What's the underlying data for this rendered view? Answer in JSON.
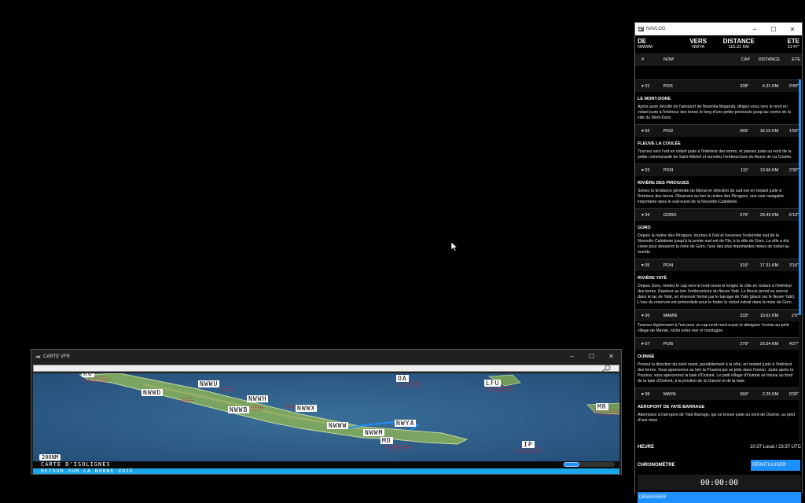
{
  "navlog": {
    "title": "NAVLOG",
    "summary_headers": {
      "from": "DE",
      "to": "VERS",
      "distance": "DISTANCE",
      "ete": "ETE"
    },
    "summary_values": {
      "from": "NWWM",
      "to": "NWYA",
      "distance": "115.31 KM",
      "ete": "21'47\""
    },
    "columns": {
      "num": "#",
      "name": "NOM",
      "cap": "CAP",
      "distance": "DISTANCE",
      "ete": "ETE"
    },
    "waypoints": [
      {
        "num": "▾ 01",
        "name": "POI1",
        "cap": "338°",
        "distance": "4.31 KM",
        "ete": "0'49\"",
        "title": "LE MONT-DORE",
        "desc": "Après avoir décollé de l'aéroport de Nouméa Magenta, dirigez-vous vers le nord en volant juste à l'intérieur des terres le long d'une petite péninsule jusqu'au centre de la ville du Mont-Dore."
      },
      {
        "num": "▾ 02",
        "name": "POI2",
        "cap": "065°",
        "distance": "16.15 KM",
        "ete": "1'55\"",
        "title": "FLEUVE LA COULÉE",
        "desc": "Tournez vers l'est en volant juste à l'intérieur des terres, et passez juste au nord de la petite communauté de Saint-Michel et survolez l'embouchure du fleuve de La Coulée."
      },
      {
        "num": "▾ 03",
        "name": "POI3",
        "cap": "111°",
        "distance": "13.66 KM",
        "ete": "2'35\"",
        "title": "RIVIÈRE DES PIROGUES",
        "desc": "Suivez la tendance générale du littoral en direction du sud-est en restant juste à l'intérieur des terres. Observez au loin la rivière des Pirogues, une voie navigable importante dans le sud-ouest de la Nouvelle-Calédonie."
      },
      {
        "num": "▾ 04",
        "name": "GORO",
        "cap": "075°",
        "distance": "33.43 KM",
        "ete": "6'19\"",
        "title": "GORO",
        "desc": "Depuis la rivière des Pirogues, tournez à l'est et traversez l'extrémité sud de la Nouvelle-Calédonie jusqu'à la pointe sud-est de l'île, à la ville de Goro. La ville a été créée pour desservir la mine de Goro, l'une des plus importantes mines de nickel au monde."
      },
      {
        "num": "▾ 05",
        "name": "POI4",
        "cap": "316°",
        "distance": "17.31 KM",
        "ete": "3'16\"",
        "title": "RIVIÈRE YATÉ",
        "desc": "Depuis Goro, mettez le cap vers le nord-ouest et longez la côte en restant à l'intérieur des terres. Repérez au loin l'embouchure du fleuve Yaté. Le fleuve prend sa source dans le lac de Yaté, un réservoir formé par le barrage de Yaté (placé sur le fleuve Yaté). L'eau du réservoir est primordiale pour le traiter le nickel extrait dans la mine de Goro."
      },
      {
        "num": "▾ 06",
        "name": "MAMIÉ",
        "cap": "333°",
        "distance": "10.61 KM",
        "ete": "2'0\"",
        "title": "",
        "desc": "Tournez légèrement à l'est pour un cap nord-nord-ouest et atteignez l'océan au petit village de Mamié, niché entre mer et montagne."
      },
      {
        "num": "▾ 07",
        "name": "POI5",
        "cap": "279°",
        "distance": "23.54 KM",
        "ete": "4'27\"",
        "title": "OUINNÉ",
        "desc": "Prenez la direction du nord-ouest, parallèlement à la côte, en restant juste à l'intérieur des terres. Vous apercevrez au loin la Pourina qui se jette dans l'océan. Juste après la Pourina, vous apercevrez la baie d'Ouinné. Le petit village d'Ouinné se trouve au fond de la baie d'Ouinné, à la jonction de la Ouinné et de la baie."
      },
      {
        "num": "▾ 08",
        "name": "NWYA",
        "cap": "360°",
        "distance": "2.29 KM",
        "ete": "0'26\"",
        "title": "AÉROPORT DE YATÉ-BARRAGE",
        "desc": "Atterrissez à l'aéroport de Yaté-Barrage, qui se trouve juste au nord de Ouinné, au pied d'une mine"
      }
    ],
    "heure_label": "HEURE",
    "heure_value": "10:37 Local / 23:37 UTC",
    "chrono_label": "CHRONOMÈTRE",
    "reset_label": "RÉINITIALISER",
    "timer": "00:00:00",
    "start_label": "DÉMARRER"
  },
  "carte": {
    "title": "CARTE VFR",
    "search_value": "",
    "labels": [
      "NWWU",
      "NWWD",
      "NWWH",
      "NWWB",
      "NWWX",
      "NWYA",
      "NWWW",
      "NWWM",
      "MD",
      "OA",
      "LFU",
      "MR",
      "IP",
      "KO"
    ],
    "scale": "200NM",
    "status": "CARTE D'ISOLIGNES",
    "banner": "RETOUR SUR LA BONNE VOIE"
  },
  "colors": {
    "accent": "#1e90ff",
    "ocean": "#2d5b86",
    "land": "#6f9a5a",
    "banner": "#1aa6e8"
  }
}
